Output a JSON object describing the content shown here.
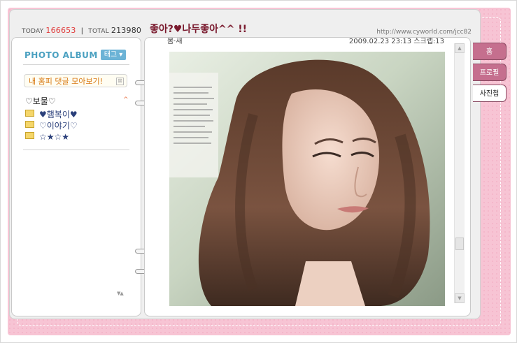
{
  "header": {
    "today_label": "TODAY",
    "today_count": "166653",
    "separator": "|",
    "total_label": "TOTAL",
    "total_count": "213980",
    "title": "좋아?♥나두좋아^^ !!",
    "url": "http://www.cyworld.com/jcc82"
  },
  "album": {
    "title": "PHOTO ALBUM",
    "tag_button": "태그 ▾",
    "comment_button": "내 홈피 댓글 모아보기!",
    "comment_close_icon": "⊠",
    "folder_heading": "♡보물♡",
    "collapse_icon": "^",
    "folders": [
      {
        "label": "♥햄복이♥"
      },
      {
        "label": "♡이야기♡"
      },
      {
        "label": "☆★☆★"
      }
    ],
    "scroll_arrows": "▼▲"
  },
  "photo": {
    "header_label": "봄·새",
    "header_date": "2009.02.23 23:13  스크랩:13"
  },
  "scrollbar": {
    "up_arrow": "▲",
    "down_arrow": "▼"
  },
  "tabs": [
    {
      "label": "홈",
      "state": "inactive"
    },
    {
      "label": "프로필",
      "state": "inactive"
    },
    {
      "label": "사진첩",
      "state": "active"
    }
  ],
  "colors": {
    "frame_pink": "#f7c4d4",
    "tab_inactive": "#c56f8e",
    "album_title": "#4aa0c0",
    "today_count": "#e03a3a"
  }
}
